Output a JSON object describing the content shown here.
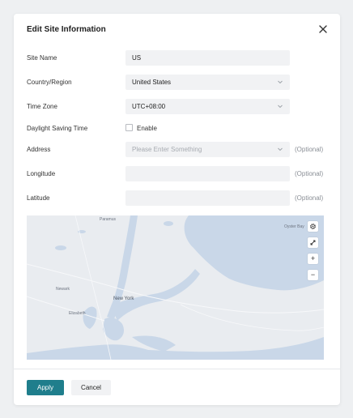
{
  "dialog": {
    "title": "Edit Site Information",
    "close_icon": "close-icon"
  },
  "form": {
    "site_name": {
      "label": "Site Name",
      "value": "US"
    },
    "country_region": {
      "label": "Country/Region",
      "value": "United States"
    },
    "time_zone": {
      "label": "Time Zone",
      "value": "UTC+08:00"
    },
    "daylight_saving": {
      "label": "Daylight Saving Time",
      "checkbox_label": "Enable",
      "checked": false
    },
    "address": {
      "label": "Address",
      "placeholder": "Please Enter Something",
      "value": "",
      "hint": "(Optional)"
    },
    "longitude": {
      "label": "Longitude",
      "value": "",
      "hint": "(Optional)"
    },
    "latitude": {
      "label": "Latitude",
      "value": "",
      "hint": "(Optional)"
    }
  },
  "map": {
    "controls": [
      "gear-icon",
      "fullscreen-icon",
      "zoom-in-icon",
      "zoom-out-icon"
    ],
    "zoom_in": "+",
    "zoom_out": "−",
    "city_label": "New York",
    "place_labels": [
      "Paramus",
      "Newark",
      "Oyster Bay",
      "Elizabeth"
    ]
  },
  "footer": {
    "apply_label": "Apply",
    "cancel_label": "Cancel"
  },
  "colors": {
    "accent": "#1f7e8c",
    "field_bg": "#f1f2f4",
    "map_water": "#c9d7e8",
    "map_land": "#e9ecf0"
  }
}
